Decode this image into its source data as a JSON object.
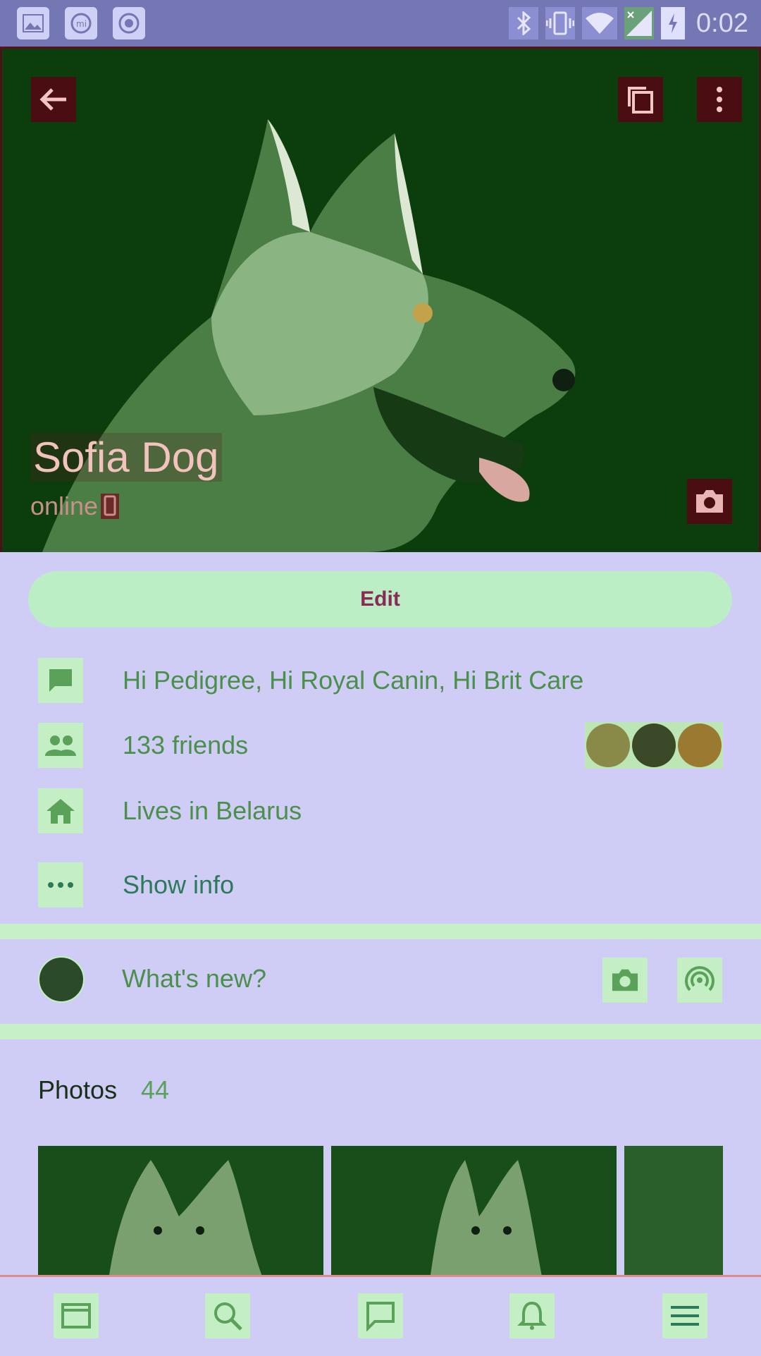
{
  "status_bar": {
    "time": "0:02",
    "left_icons": [
      "image-icon",
      "mi-icon",
      "record-icon"
    ],
    "right_icons": [
      "bluetooth-icon",
      "vibrate-icon",
      "wifi-icon",
      "signal-icon",
      "battery-charging-icon"
    ]
  },
  "profile": {
    "name": "Sofia Dog",
    "status": "online"
  },
  "actions": {
    "edit_label": "Edit"
  },
  "info": {
    "status_text": "Hi Pedigree, Hi Royal Canin, Hi Brit Care",
    "friends": "133 friends",
    "location": "Lives in Belarus",
    "show_info": "Show info"
  },
  "post": {
    "placeholder": "What's new?"
  },
  "photos": {
    "title": "Photos",
    "count": "44"
  },
  "bottom_nav": [
    "feed-icon",
    "search-icon",
    "messages-icon",
    "notifications-icon",
    "menu-icon"
  ],
  "colors": {
    "accent_green": "#4a8f4a",
    "hero_bg": "#0c3f0e",
    "card_bg": "#cfcdf6",
    "edit_bg": "#bceec6"
  }
}
